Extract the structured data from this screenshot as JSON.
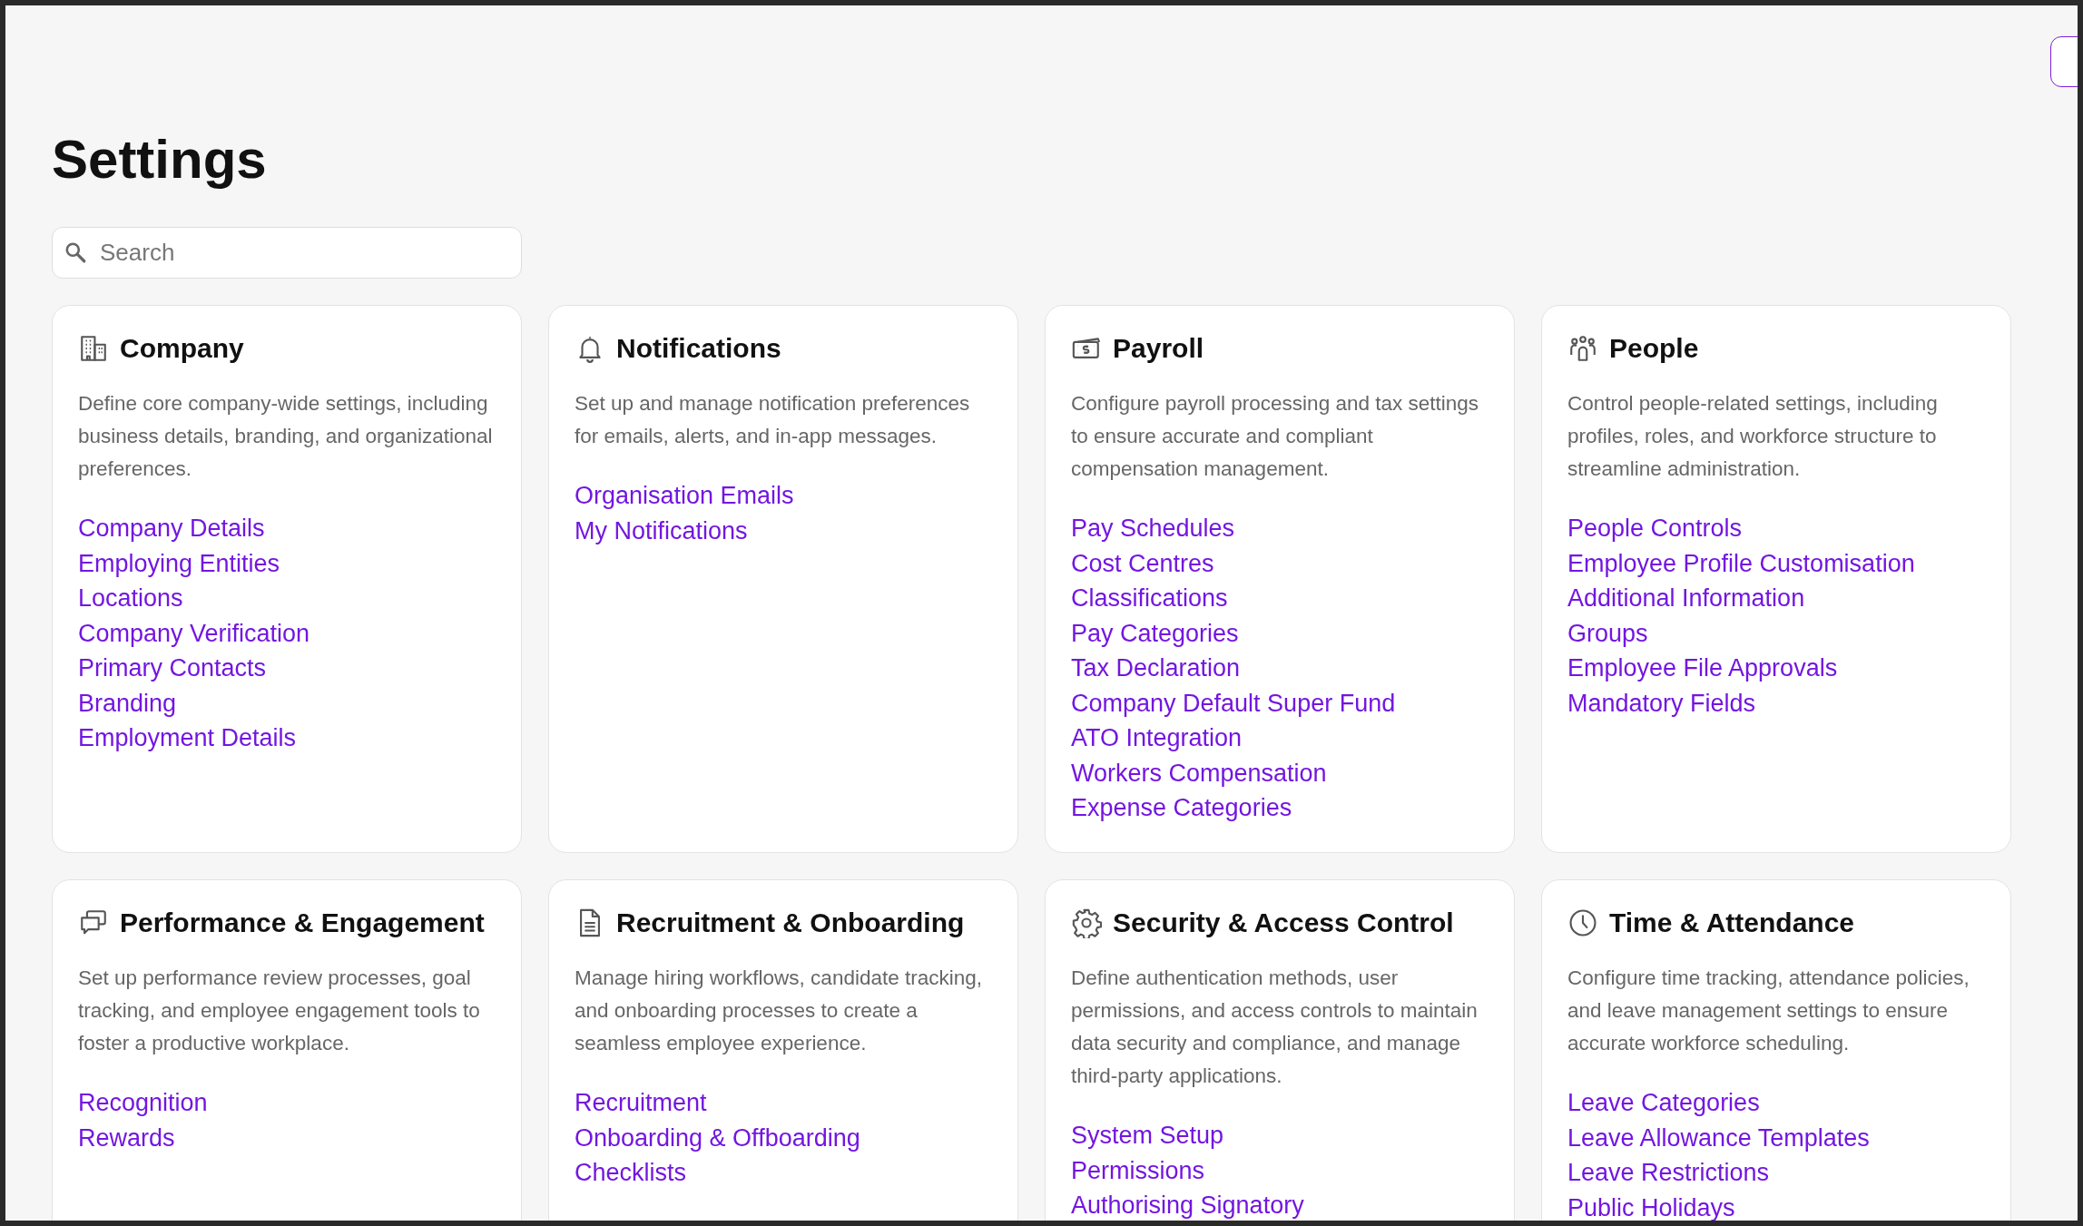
{
  "title": "Settings",
  "search": {
    "placeholder": "Search"
  },
  "cards": [
    {
      "title": "Company",
      "description": "Define core company-wide settings, including business details, branding, and organizational preferences.",
      "links": [
        "Company Details",
        "Employing Entities",
        "Locations",
        "Company Verification",
        "Primary Contacts",
        "Branding",
        "Employment Details"
      ]
    },
    {
      "title": "Notifications",
      "description": "Set up and manage notification preferences for emails, alerts, and in-app messages.",
      "links": [
        "Organisation Emails",
        "My Notifications"
      ]
    },
    {
      "title": "Payroll",
      "description": "Configure payroll processing and tax settings to ensure accurate and compliant compensation management.",
      "links": [
        "Pay Schedules",
        "Cost Centres",
        "Classifications",
        "Pay Categories",
        "Tax Declaration",
        "Company Default Super Fund",
        "ATO Integration",
        "Workers Compensation",
        "Expense Categories"
      ]
    },
    {
      "title": "People",
      "description": "Control people-related settings, including profiles, roles, and workforce structure to streamline administration.",
      "links": [
        "People Controls",
        "Employee Profile Customisation",
        "Additional Information",
        "Groups",
        "Employee File Approvals",
        "Mandatory Fields"
      ]
    },
    {
      "title": "Performance & Engagement",
      "description": "Set up performance review processes, goal tracking, and employee engagement tools to foster a productive workplace.",
      "links": [
        "Recognition",
        "Rewards"
      ]
    },
    {
      "title": "Recruitment & Onboarding",
      "description": "Manage hiring workflows, candidate tracking, and onboarding processes to create a seamless employee experience.",
      "links": [
        "Recruitment",
        "Onboarding & Offboarding",
        "Checklists"
      ]
    },
    {
      "title": "Security & Access Control",
      "description": "Define authentication methods, user permissions, and access controls to maintain data security and compliance, and manage third-party applications.",
      "links": [
        "System Setup",
        "Permissions",
        "Authorising Signatory"
      ]
    },
    {
      "title": "Time & Attendance",
      "description": "Configure time tracking, attendance policies, and leave management settings to ensure accurate workforce scheduling.",
      "links": [
        "Leave Categories",
        "Leave Allowance Templates",
        "Leave Restrictions",
        "Public Holidays"
      ]
    }
  ]
}
